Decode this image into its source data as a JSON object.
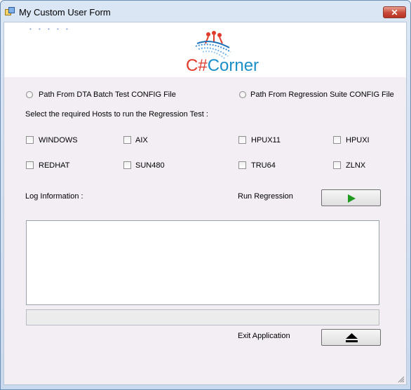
{
  "window": {
    "title": "My Custom User Form",
    "close_glyph": "✕"
  },
  "banner": {
    "dots": "• • • • •",
    "logo_hash": "C#",
    "logo_word": "Corner"
  },
  "source": {
    "option_dta": "Path From DTA Batch Test CONFIG File",
    "option_regression": "Path From Regression Suite CONFIG File"
  },
  "hosts": {
    "prompt": "Select the required Hosts to run the Regression Test :",
    "items": [
      "WINDOWS",
      "AIX",
      "HPUX11",
      "HPUXI",
      "REDHAT",
      "SUN480",
      "TRU64",
      "ZLNX"
    ]
  },
  "log": {
    "label": "Log Information :",
    "content": ""
  },
  "actions": {
    "run_label": "Run Regression",
    "exit_label": "Exit Application"
  },
  "icons": {
    "app": "form-icon",
    "run": "play-icon",
    "exit": "eject-icon"
  },
  "colors": {
    "form_background": "#f2eef4",
    "play_green": "#1f9a1f",
    "logo_blue": "#1a8fc8",
    "logo_red": "#e03a2a"
  }
}
